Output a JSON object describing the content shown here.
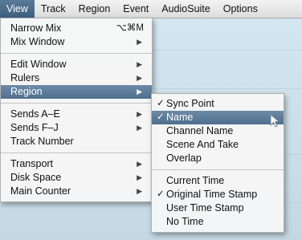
{
  "menubar": {
    "items": [
      {
        "label": "View",
        "active": true
      },
      {
        "label": "Track",
        "active": false
      },
      {
        "label": "Region",
        "active": false
      },
      {
        "label": "Event",
        "active": false
      },
      {
        "label": "AudioSuite",
        "active": false
      },
      {
        "label": "Options",
        "active": false
      }
    ]
  },
  "view_menu": {
    "groups": [
      [
        {
          "label": "Narrow Mix",
          "shortcut": "⌥⌘M"
        },
        {
          "label": "Mix Window",
          "has_submenu": true
        }
      ],
      [
        {
          "label": "Edit Window",
          "has_submenu": true
        },
        {
          "label": "Rulers",
          "has_submenu": true
        },
        {
          "label": "Region",
          "has_submenu": true,
          "highlighted": true
        }
      ],
      [
        {
          "label": "Sends A–E",
          "has_submenu": true
        },
        {
          "label": "Sends F–J",
          "has_submenu": true
        },
        {
          "label": "Track Number"
        }
      ],
      [
        {
          "label": "Transport",
          "has_submenu": true
        },
        {
          "label": "Disk Space",
          "has_submenu": true
        },
        {
          "label": "Main Counter",
          "has_submenu": true
        }
      ]
    ]
  },
  "region_submenu": {
    "groups": [
      [
        {
          "label": "Sync Point",
          "checked": true
        },
        {
          "label": "Name",
          "checked": true,
          "highlighted": true
        },
        {
          "label": "Channel Name",
          "checked": false
        },
        {
          "label": "Scene And Take",
          "checked": false
        },
        {
          "label": "Overlap",
          "checked": false
        }
      ],
      [
        {
          "label": "Current Time",
          "checked": false
        },
        {
          "label": "Original Time Stamp",
          "checked": true
        },
        {
          "label": "User Time Stamp",
          "checked": false
        },
        {
          "label": "No Time",
          "checked": false
        }
      ]
    ]
  },
  "glyphs": {
    "check": "✓",
    "submenu_arrow": "▶"
  },
  "colors": {
    "highlight": "#5a7a99",
    "background": "#c9dce8"
  }
}
